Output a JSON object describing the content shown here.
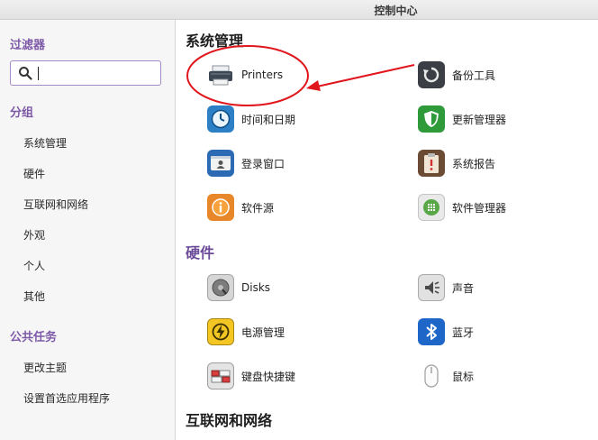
{
  "window": {
    "title": "控制中心"
  },
  "sidebar": {
    "filter_heading": "过滤器",
    "search": {
      "value": "",
      "placeholder": ""
    },
    "group_heading": "分组",
    "groups": [
      "系统管理",
      "硬件",
      "互联网和网络",
      "外观",
      "个人",
      "其他"
    ],
    "tasks_heading": "公共任务",
    "tasks": [
      "更改主题",
      "设置首选应用程序"
    ]
  },
  "sections": [
    {
      "title": "系统管理",
      "items": [
        {
          "label": "Printers",
          "icon": "printer-icon"
        },
        {
          "label": "备份工具",
          "icon": "backup-icon"
        },
        {
          "label": "时间和日期",
          "icon": "clock-icon"
        },
        {
          "label": "更新管理器",
          "icon": "shield-icon"
        },
        {
          "label": "登录窗口",
          "icon": "login-window-icon"
        },
        {
          "label": "系统报告",
          "icon": "clipboard-icon"
        },
        {
          "label": "软件源",
          "icon": "info-icon"
        },
        {
          "label": "软件管理器",
          "icon": "app-grid-icon"
        }
      ]
    },
    {
      "title": "硬件",
      "items": [
        {
          "label": "Disks",
          "icon": "disk-icon"
        },
        {
          "label": "声音",
          "icon": "speaker-icon"
        },
        {
          "label": "电源管理",
          "icon": "power-icon"
        },
        {
          "label": "蓝牙",
          "icon": "bluetooth-icon"
        },
        {
          "label": "键盘快捷键",
          "icon": "keyboard-icon"
        },
        {
          "label": "鼠标",
          "icon": "mouse-icon"
        }
      ]
    },
    {
      "title": "互联网和网络",
      "items": []
    }
  ],
  "colors": {
    "accent": "#7d5aa8",
    "annotation": "#e0161c"
  }
}
